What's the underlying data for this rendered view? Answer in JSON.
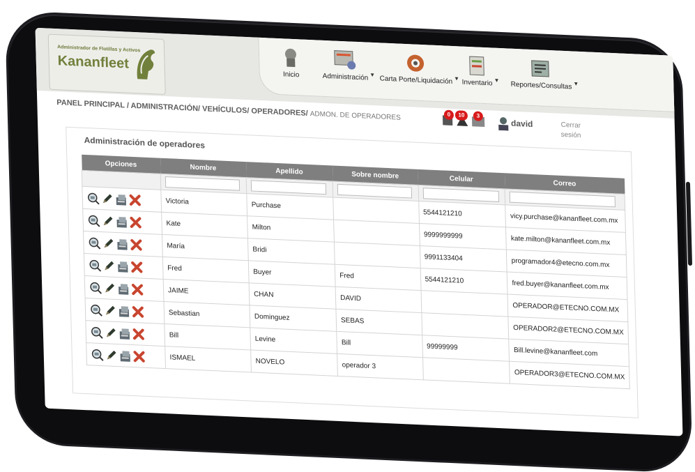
{
  "header": {
    "logo_subtitle": "Administrador de Flotillas y Activos",
    "logo_name": "Kananfleet",
    "nav": [
      {
        "label": "Inicio",
        "icon": "home-icon"
      },
      {
        "label": "Administración",
        "icon": "admin-icon"
      },
      {
        "label": "Carta Porte/Liquidación",
        "icon": "gear-icon"
      },
      {
        "label": "Inventario",
        "icon": "inventory-icon"
      },
      {
        "label": "Reportes/Consultas",
        "icon": "reports-icon"
      }
    ],
    "breadcrumb": {
      "parts": "PANEL PRINCIPAL / ADMINISTRACIÓN/ VEHÍCULOS/ OPERADORES/",
      "current": "ADMON. DE OPERADORES"
    },
    "alerts": {
      "a": "0",
      "b": "10",
      "c": "3"
    },
    "user": "david",
    "logout": "Cerrar sesión"
  },
  "panel": {
    "title": "Administración de operadores",
    "columns": [
      "Opciones",
      "Nombre",
      "Apellido",
      "Sobre nombre",
      "Celular",
      "Correo"
    ],
    "rows": [
      {
        "nombre": "Victoria",
        "apellido": "Purchase",
        "sobre": "",
        "celular": "5544121210",
        "correo": "vicy.purchase@kananfleet.com.mx"
      },
      {
        "nombre": "Kate",
        "apellido": "Milton",
        "sobre": "",
        "celular": "9999999999",
        "correo": "kate.milton@kananfleet.com.mx"
      },
      {
        "nombre": "María",
        "apellido": "Bridi",
        "sobre": "",
        "celular": "9991133404",
        "correo": "programador4@etecno.com.mx"
      },
      {
        "nombre": "Fred",
        "apellido": "Buyer",
        "sobre": "Fred",
        "celular": "5544121210",
        "correo": "fred.buyer@kananfleet.com.mx"
      },
      {
        "nombre": "JAIME",
        "apellido": "CHAN",
        "sobre": "DAVID",
        "celular": "",
        "correo": "OPERADOR@ETECNO.COM.MX"
      },
      {
        "nombre": "Sebastian",
        "apellido": "Dominguez",
        "sobre": "SEBAS",
        "celular": "",
        "correo": "OPERADOR2@ETECNO.COM.MX"
      },
      {
        "nombre": "Bill",
        "apellido": "Levine",
        "sobre": "Bill",
        "celular": "99999999",
        "correo": "Bill.levine@kananfleet.com"
      },
      {
        "nombre": "ISMAEL",
        "apellido": "NOVELO",
        "sobre": "operador 3",
        "celular": "",
        "correo": "OPERADOR3@ETECNO.COM.MX"
      }
    ]
  },
  "colors": {
    "accent": "#71803b",
    "header_bg": "#7f7f7f",
    "delete": "#c8452f"
  }
}
